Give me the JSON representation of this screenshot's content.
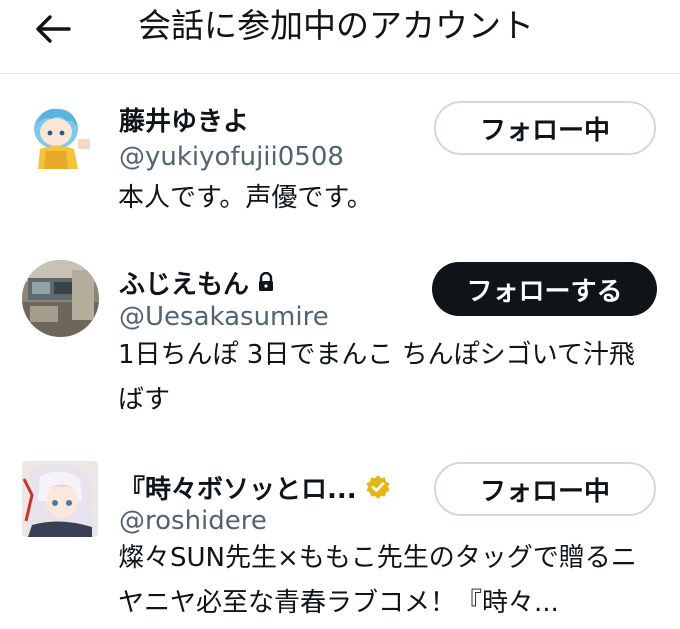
{
  "header": {
    "back_icon": "arrow-left-icon",
    "title": "会話に参加中のアカウント"
  },
  "accounts": [
    {
      "display_name": "藤井ゆきよ",
      "handle": "@yukiyofujii0508",
      "button_label": "フォロー中",
      "bio": "本人です。声優です。",
      "avatar": "anime-girl-avatar"
    },
    {
      "display_name": "ふじえもん",
      "badge_icon": "lock-icon",
      "handle": "@Uesakasumire",
      "button_label": "フォローする",
      "bio": "1日ちんぽ 3日でまんこ ちんぽシゴいて汁飛ばす",
      "avatar": "room-photo-avatar"
    },
    {
      "display_name": "『時々ボソッとロ...",
      "badge_icon": "verified-gold-icon",
      "handle": "@roshidere",
      "button_label": "フォロー中",
      "bio": "燦々SUN先生×ももこ先生のタッグで贈るニヤニヤ必至な青春ラブコメ！『時々...",
      "avatar": "anime-silver-hair-avatar"
    }
  ],
  "colors": {
    "text_primary": "#0f1419",
    "text_secondary": "#536471",
    "border": "#cfd9de",
    "follow_button_bg": "#0f1419",
    "verified_gold": "#e2b719"
  }
}
